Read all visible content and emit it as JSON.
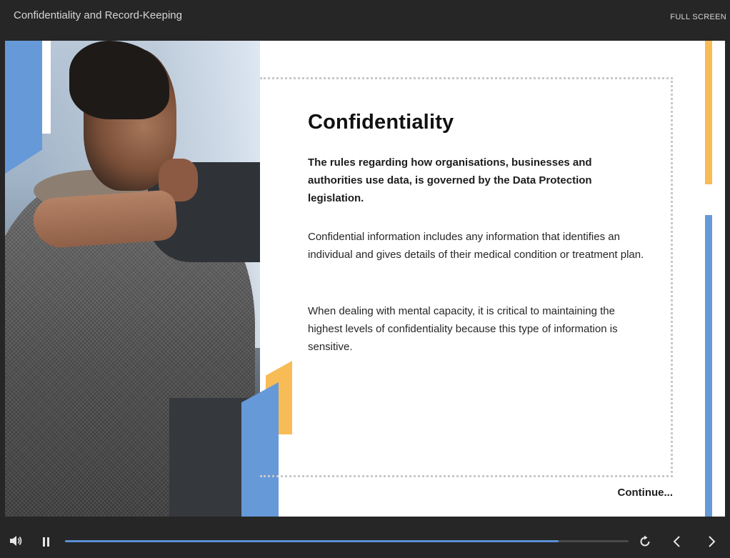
{
  "header": {
    "title": "Confidentiality and Record-Keeping",
    "fullscreen_label": "FULL SCREEN"
  },
  "slide": {
    "heading": "Confidentiality",
    "lead": "The rules regarding how organisations, businesses and authorities use data,  is governed by the Data Protection legislation.",
    "paragraphs": [
      "Confidential information includes any information that identifies an individual and gives details of their medical condition or treatment plan.",
      "When dealing with mental capacity, it is critical to maintaining the highest levels of confidentiality because this type of information is sensitive."
    ],
    "continue_label": "Continue..."
  },
  "player": {
    "progress_fraction": 0.876,
    "icons": [
      "volume-icon",
      "pause-icon",
      "replay-icon",
      "prev-icon",
      "next-icon"
    ]
  },
  "colors": {
    "accent_blue": "#6699d8",
    "accent_yellow": "#f7bc55",
    "progress_blue": "#5b8fd6",
    "chrome_bg": "#262626"
  }
}
